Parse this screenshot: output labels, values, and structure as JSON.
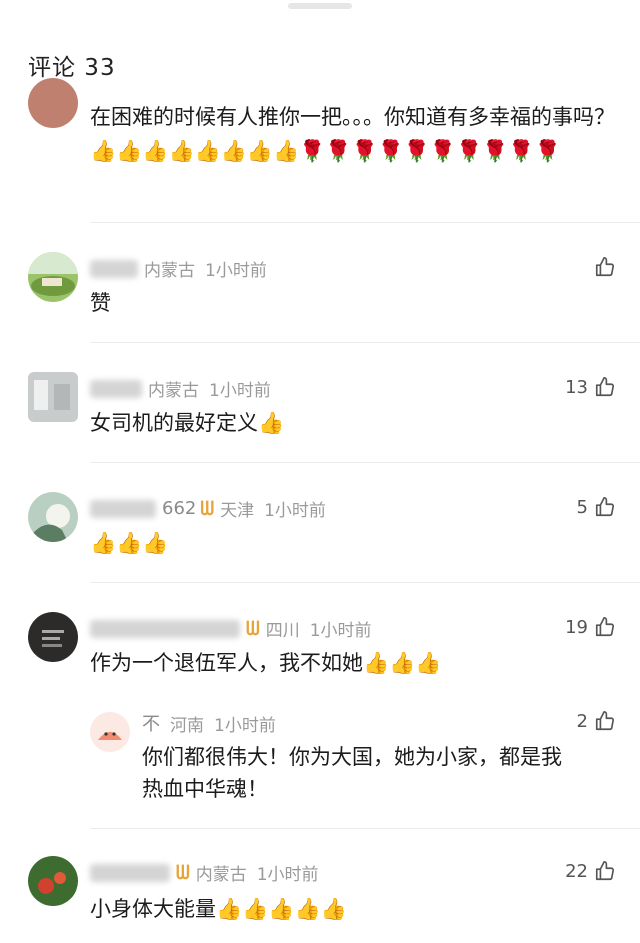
{
  "header": {
    "title": "评论 33"
  },
  "comments": [
    {
      "text": "在困难的时候有人推你一把。。。你知道有多幸福的事吗？👍👍👍👍👍👍👍👍🌹🌹🌹🌹🌹🌹🌹🌹🌹🌹"
    },
    {
      "name_visible": "",
      "location": "内蒙古",
      "time": "1小时前",
      "likes": "",
      "text": "赞"
    },
    {
      "name_visible": "",
      "location": "内蒙古",
      "time": "1小时前",
      "likes": "13",
      "text": "女司机的最好定义👍"
    },
    {
      "name_visible": "662",
      "location": "天津",
      "time": "1小时前",
      "likes": "5",
      "text": "👍👍👍"
    },
    {
      "name_visible": "",
      "location": "四川",
      "time": "1小时前",
      "likes": "19",
      "text": "作为一个退伍军人，我不如她👍👍👍",
      "reply": {
        "name": "不",
        "location": "河南",
        "time": "1小时前",
        "likes": "2",
        "text_line1": "你们都很伟大！你为大国，她为小家，都是我",
        "text_line2": "热血中华魂！"
      }
    },
    {
      "name_visible": "",
      "location": "内蒙古",
      "time": "1小时前",
      "likes": "22",
      "text": "小身体大能量👍👍👍👍👍"
    }
  ],
  "colors": {
    "badge": "#e8a33a",
    "meta": "#9a9a9a",
    "divider": "#ececec"
  },
  "icons": {
    "like": "thumbs-up-outline-icon",
    "vip": "vip-badge-icon"
  }
}
